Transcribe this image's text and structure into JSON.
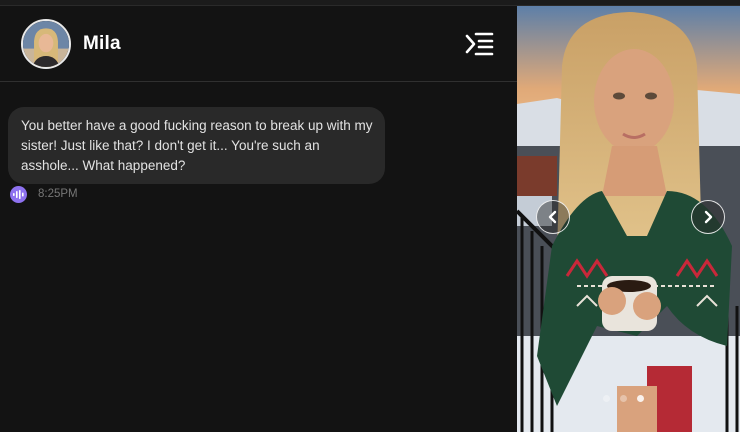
{
  "contact": {
    "name": "Mila"
  },
  "messages": [
    {
      "text": "You better have a good fucking reason to break up with my sister! Just like that? I don't get it... You're such an asshole... What happened?",
      "time": "8:25PM"
    }
  ],
  "gallery": {
    "total_images": 3,
    "active_index": 2
  },
  "colors": {
    "background": "#131313",
    "bubble": "#292929",
    "accent_voice": "#8e72f0",
    "timestamp": "#777777"
  },
  "icons": {
    "menu": "menu-collapse-icon",
    "voice": "audio-wave-icon",
    "prev": "chevron-left-icon",
    "next": "chevron-right-icon"
  }
}
